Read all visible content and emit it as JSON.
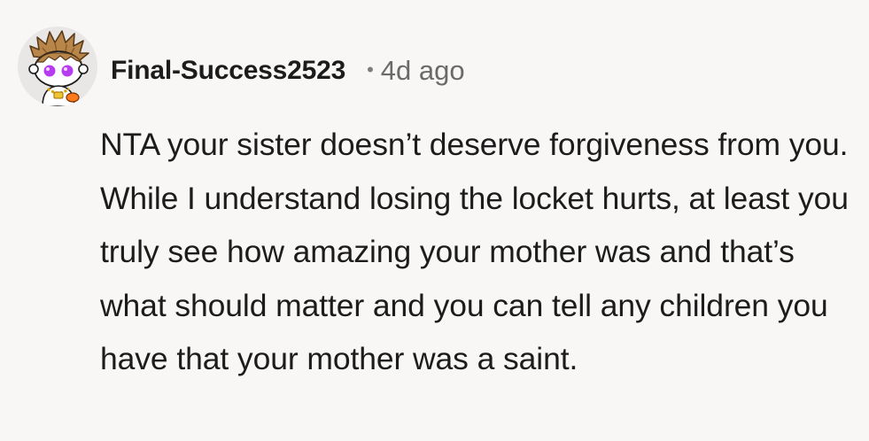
{
  "comment": {
    "avatar_icon": "snoo-avatar-icon",
    "username": "Final-Success2523",
    "separator": "•",
    "timestamp": "4d ago",
    "text": "NTA your sister doesn’t deserve forgiveness from you. While I understand losing the locket hurts, at least you truly see how amazing your mother was and that’s what should matter and you can tell any children you have that your mother was a saint."
  },
  "colors": {
    "background": "#f8f7f5",
    "text": "#1c1c1c",
    "meta": "#6a6a6a"
  }
}
